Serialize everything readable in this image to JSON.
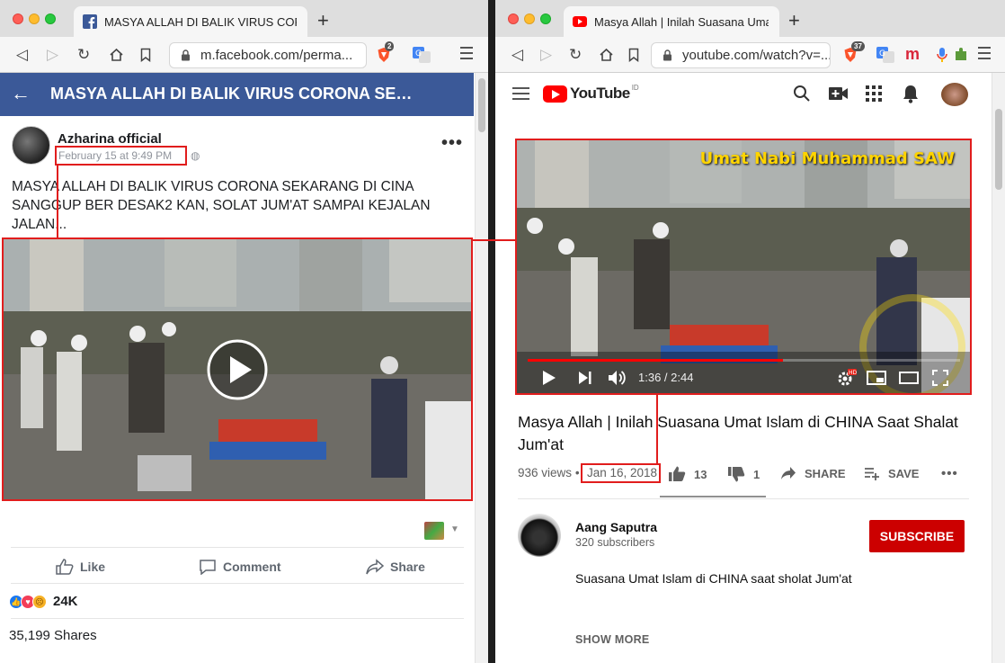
{
  "left_window": {
    "tab_title": "MASYA ALLAH DI BALIK VIRUS CORONA SEKARANG DI CINA",
    "url": "m.facebook.com/perma...",
    "ext_badge": "2",
    "fb": {
      "header_title": "MASYA ALLAH DI BALIK VIRUS CORONA SEKARANG DI CINA",
      "author": "Azharina official",
      "post_time": "February 15 at 9:49 PM",
      "post_text": "MASYA ALLAH DI BALIK VIRUS CORONA SEKARANG DI CINA SANGGUP BER DESAK2 KAN, SOLAT JUM'AT SAMPAI KEJALAN JALAN...",
      "like_label": "Like",
      "comment_label": "Comment",
      "share_label": "Share",
      "reaction_count": "24K",
      "shares_text": "35,199 Shares"
    }
  },
  "right_window": {
    "tab_title": "Masya Allah | Inilah Suasana Umat Islam di CHINA Saat Shalat Jum'at",
    "url": "youtube.com/watch?v=...",
    "ext_badge": "37",
    "yt": {
      "logo_text": "YouTube",
      "country": "ID",
      "video_overlay": "Umat Nabi Muhammad SAW",
      "time": "1:36 / 2:44",
      "progress": 0.59,
      "title": "Masya Allah | Inilah Suasana Umat Islam di CHINA Saat Shalat Jum'at",
      "views": "936 views",
      "dot": "•",
      "date": "Jan 16, 2018",
      "likes": "13",
      "dislikes": "1",
      "share_label": "SHARE",
      "save_label": "SAVE",
      "channel_name": "Aang Saputra",
      "subscribers": "320 subscribers",
      "subscribe_label": "SUBSCRIBE",
      "description": "Suasana Umat Islam di CHINA saat sholat Jum'at",
      "show_more": "SHOW MORE"
    }
  },
  "colors": {
    "fb_blue": "#3b5998",
    "yt_red": "#ff0000",
    "highlight_red": "#e11d1d"
  }
}
